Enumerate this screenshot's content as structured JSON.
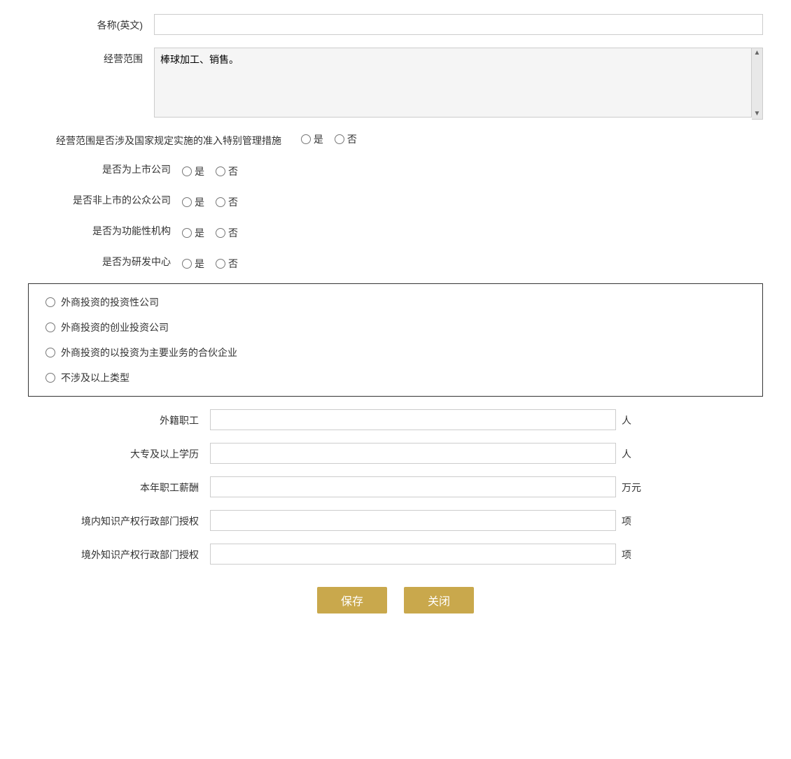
{
  "form": {
    "name_en_label": "各称(英文)",
    "name_en_placeholder": "",
    "business_scope_label": "经营范围",
    "business_scope_value": "棒球加工、销售。",
    "special_management_label": "经营范围是否涉及国家规定实施的准入特别管理措施",
    "special_management_yes": "是",
    "special_management_no": "否",
    "listed_company_label": "是否为上市公司",
    "listed_yes": "是",
    "listed_no": "否",
    "public_company_label": "是否非上市的公众公司",
    "public_yes": "是",
    "public_no": "否",
    "functional_org_label": "是否为功能性机构",
    "functional_yes": "是",
    "functional_no": "否",
    "rd_center_label": "是否为研发中心",
    "rd_yes": "是",
    "rd_no": "否",
    "investment_types": [
      "外商投资的投资性公司",
      "外商投资的创业投资公司",
      "外商投资的以投资为主要业务的合伙企业",
      "不涉及以上类型"
    ],
    "foreign_staff_label": "外籍职工",
    "foreign_staff_unit": "人",
    "foreign_staff_value": "",
    "college_edu_label": "大专及以上学历",
    "college_edu_unit": "人",
    "college_edu_value": "",
    "annual_salary_label": "本年职工薪酬",
    "annual_salary_unit": "万元",
    "annual_salary_value": "",
    "domestic_ip_label": "境内知识产权行政部门授权",
    "domestic_ip_unit": "项",
    "domestic_ip_value": "",
    "foreign_ip_label": "境外知识产权行政部门授权",
    "foreign_ip_unit": "项",
    "foreign_ip_value": "",
    "save_button": "保存",
    "close_button": "关闭"
  }
}
